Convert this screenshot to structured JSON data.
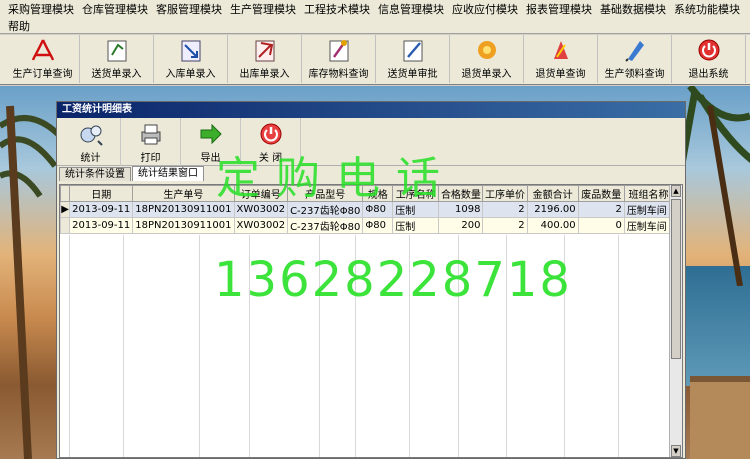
{
  "menu": {
    "row1": [
      "采购管理模块",
      "仓库管理模块",
      "客服管理模块",
      "生产管理模块",
      "工程技术模块",
      "信息管理模块",
      "应收应付模块",
      "报表管理模块",
      "基础数据模块",
      "系统功能模块"
    ],
    "row2": [
      "帮助"
    ]
  },
  "toolbar": [
    {
      "label": "生产订单查询",
      "icon": "pdf-icon"
    },
    {
      "label": "送货单录入",
      "icon": "delivery-note-icon"
    },
    {
      "label": "入库单录入",
      "icon": "stock-in-icon"
    },
    {
      "label": "出库单录入",
      "icon": "stock-out-icon"
    },
    {
      "label": "库存物料查询",
      "icon": "inventory-icon"
    },
    {
      "label": "送货单审批",
      "icon": "approve-icon"
    },
    {
      "label": "退货单录入",
      "icon": "return-entry-icon"
    },
    {
      "label": "退货单查询",
      "icon": "return-query-icon"
    },
    {
      "label": "生产领料查询",
      "icon": "material-query-icon"
    },
    {
      "label": "退出系统",
      "icon": "exit-icon"
    }
  ],
  "window": {
    "title": "工资统计明细表",
    "tools": [
      {
        "label": "统计",
        "icon": "stats-icon"
      },
      {
        "label": "打印",
        "icon": "printer-icon"
      },
      {
        "label": "导出",
        "icon": "export-arrow-icon"
      },
      {
        "label": "关 闭",
        "icon": "close-power-icon"
      }
    ],
    "tabs": [
      "统计条件设置",
      "统计结果窗口"
    ],
    "active_tab": 1
  },
  "table": {
    "columns": [
      "日期",
      "生产单号",
      "订单编号",
      "产品型号",
      "规格",
      "工序名称",
      "合格数量",
      "工序单价",
      "金额合计",
      "废品数量",
      "班组名称"
    ],
    "rows": [
      [
        "2013-09-11",
        "18PN20130911001",
        "XW03002",
        "C-237齿轮Φ80",
        "Φ80",
        "压制",
        "1098",
        "2",
        "2196.00",
        "2",
        "压制车间"
      ],
      [
        "2013-09-11",
        "18PN20130911001",
        "XW03002",
        "C-237齿轮Φ80",
        "Φ80",
        "压制",
        "200",
        "2",
        "400.00",
        "0",
        "压制车间"
      ]
    ]
  },
  "watermark": {
    "text1": "定购电话",
    "text2": "13628228718"
  }
}
